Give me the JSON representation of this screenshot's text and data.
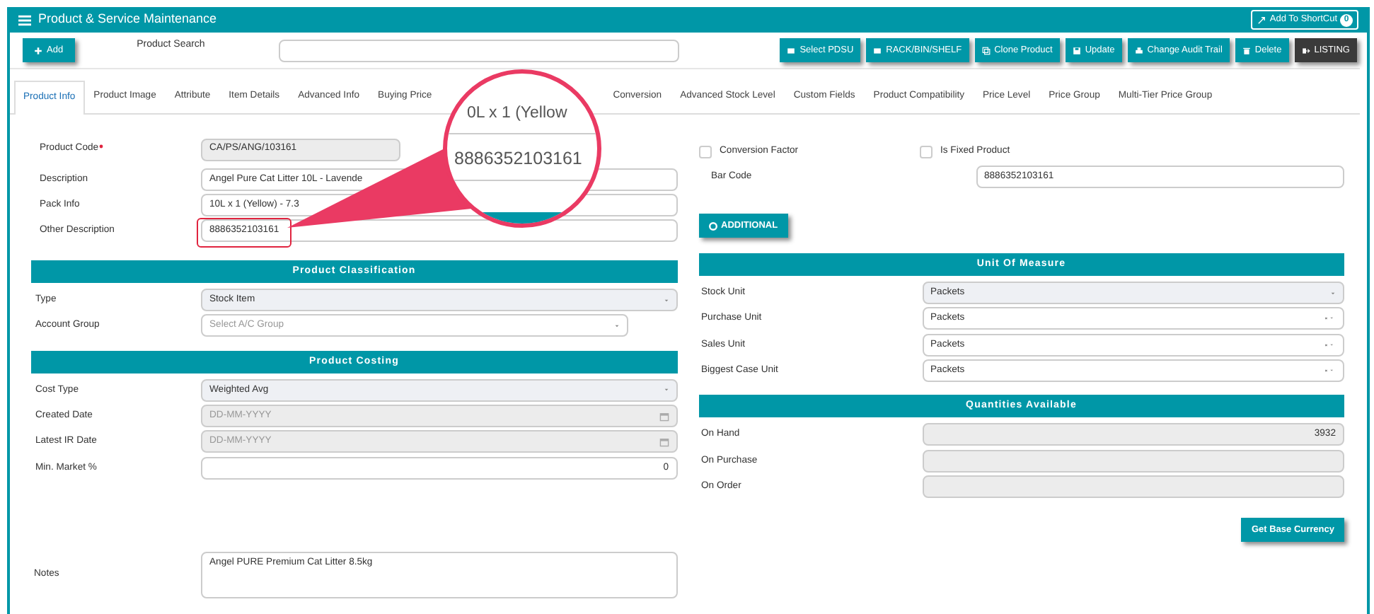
{
  "header": {
    "title": "Product & Service Maintenance",
    "shortcut": "Add To ShortCut",
    "shortcut_count": "0"
  },
  "toolbar": {
    "add": "Add",
    "search_label": "Product Search",
    "buttons": [
      {
        "label": "Select PDSU"
      },
      {
        "label": "RACK/BIN/SHELF"
      },
      {
        "label": "Clone Product"
      },
      {
        "label": "Update"
      },
      {
        "label": "Change Audit Trail"
      },
      {
        "label": "Delete"
      },
      {
        "label": "LISTING"
      }
    ]
  },
  "tabs": [
    {
      "label": "Product Info",
      "selected": true
    },
    {
      "label": "Product Image",
      "selected": false
    },
    {
      "label": "Attribute",
      "selected": false
    },
    {
      "label": "Item Details",
      "selected": false
    },
    {
      "label": "Advanced Info",
      "selected": false
    },
    {
      "label": "Buying Price",
      "selected": false
    },
    {
      "label": "Conversion",
      "selected": false
    },
    {
      "label": "Advanced Stock Level",
      "selected": false
    },
    {
      "label": "Custom Fields",
      "selected": false
    },
    {
      "label": "Product Compatibility",
      "selected": false
    },
    {
      "label": "Price Level",
      "selected": false
    },
    {
      "label": "Price Group",
      "selected": false
    },
    {
      "label": "Multi-Tier Price Group",
      "selected": false
    }
  ],
  "general": [
    {
      "label": "Product Code",
      "required": true,
      "kind": "readonly",
      "value": "CA/PS/ANG/103161",
      "highlighted": false
    },
    {
      "label": "Description",
      "required": false,
      "kind": "text",
      "value": "Angel Pure Cat Litter 10L - Lavende",
      "highlighted": false
    },
    {
      "label": "Pack Info",
      "required": false,
      "kind": "text",
      "value": "10L x 1 (Yellow) - 7.3",
      "highlighted": false
    },
    {
      "label": "Other Description",
      "required": false,
      "kind": "text",
      "value": "8886352103161",
      "highlighted": true
    }
  ],
  "options": {
    "checkboxes": [
      {
        "label": "Conversion Factor",
        "checked": false
      },
      {
        "label": "Is Fixed Product",
        "checked": false
      }
    ],
    "bar_code": {
      "label": "Bar Code",
      "value": "8886352103161"
    },
    "additional": "ADDITIONAL"
  },
  "left_sections": [
    {
      "title": "Product Classification",
      "fields": [
        {
          "label": "Type",
          "kind": "select-locked",
          "value": "Stock Item"
        },
        {
          "label": "Account Group",
          "kind": "select",
          "placeholder": "Select A/C Group"
        }
      ]
    },
    {
      "title": "Product Costing",
      "fields": [
        {
          "label": "Cost Type",
          "kind": "select-locked",
          "value": "Weighted Avg"
        },
        {
          "label": "Created Date",
          "kind": "date",
          "placeholder": "DD-MM-YYYY"
        },
        {
          "label": "Latest IR Date",
          "kind": "date",
          "placeholder": "DD-MM-YYYY"
        },
        {
          "label": "Min. Market %",
          "kind": "number",
          "value": "0"
        }
      ]
    }
  ],
  "right_sections": [
    {
      "title": "Unit Of Measure",
      "fields": [
        {
          "label": "Stock Unit",
          "kind": "select-locked",
          "value": "Packets"
        },
        {
          "label": "Purchase Unit",
          "kind": "select-clear",
          "value": "Packets"
        },
        {
          "label": "Sales Unit",
          "kind": "select-clear",
          "value": "Packets"
        },
        {
          "label": "Biggest Case Unit",
          "kind": "select-clear",
          "value": "Packets"
        }
      ]
    },
    {
      "title": "Quantities Available",
      "fields": [
        {
          "label": "On Hand",
          "kind": "readonly-number",
          "value": "3932"
        },
        {
          "label": "On Purchase",
          "kind": "readonly-number"
        },
        {
          "label": "On Order",
          "kind": "readonly-number"
        }
      ]
    }
  ],
  "get_base_currency": "Get Base Currency",
  "notes": {
    "label": "Notes",
    "value": "Angel PURE Premium Cat Litter 8.5kg"
  },
  "callout": {
    "top_text": "0L x 1 (Yellow",
    "main_text": "8886352103161"
  }
}
